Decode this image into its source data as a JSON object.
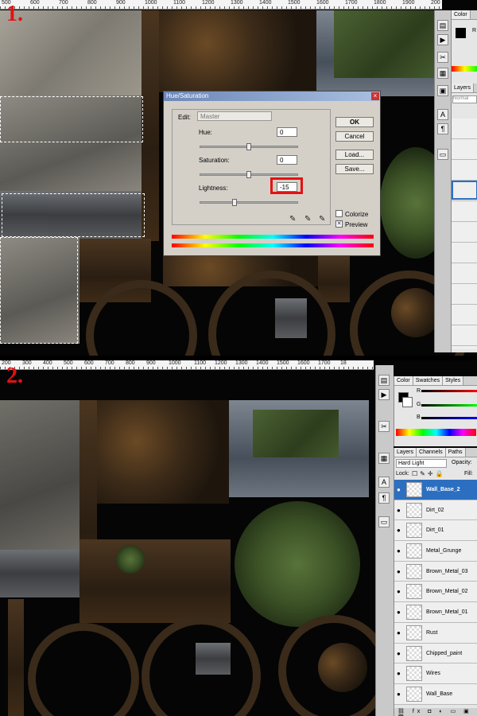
{
  "steps": [
    "1.",
    "2."
  ],
  "ruler1": [
    "500",
    "600",
    "700",
    "800",
    "900",
    "1000",
    "1100",
    "1200",
    "1300",
    "1400",
    "1500",
    "1600",
    "1700",
    "1800",
    "1900",
    "200"
  ],
  "ruler2": [
    "200",
    "300",
    "400",
    "500",
    "600",
    "700",
    "800",
    "900",
    "1000",
    "1100",
    "1200",
    "1300",
    "1400",
    "1500",
    "1600",
    "1700",
    "18"
  ],
  "dialog": {
    "title": "Hue/Saturation",
    "edit_label": "Edit:",
    "edit_value": "Master",
    "hue_label": "Hue:",
    "hue_value": "0",
    "saturation_label": "Saturation:",
    "saturation_value": "0",
    "lightness_label": "Lightness:",
    "lightness_value": "-15",
    "ok": "OK",
    "cancel": "Cancel",
    "load": "Load...",
    "save": "Save...",
    "colorize": "Colorize",
    "preview": "Preview",
    "preview_checked": true
  },
  "panel1": {
    "color_tab": "Color",
    "layers_tab": "Layers",
    "blend_mode": "Normal",
    "color_label": "R"
  },
  "panel2": {
    "color_tabs": [
      "Color",
      "Swatches",
      "Styles"
    ],
    "channels": [
      "R",
      "G",
      "B"
    ],
    "layers_tabs": [
      "Layers",
      "Channels",
      "Paths"
    ],
    "blend_mode": "Hard Light",
    "opacity_label": "Opacity:",
    "lock_label": "Lock:",
    "fill_label": "Fill:",
    "layers": [
      "Wall_Base_2",
      "Dirt_02",
      "Dirt_01",
      "Metal_Grunge",
      "Brown_Metal_03",
      "Brown_Metal_02",
      "Brown_Metal_01",
      "Rust",
      "Chipped_paint",
      "Wires",
      "Wall_Base"
    ],
    "selected_layer": "Wall_Base_2"
  },
  "colors": {
    "accent": "#e41212",
    "selected": "#2c6fc0"
  }
}
